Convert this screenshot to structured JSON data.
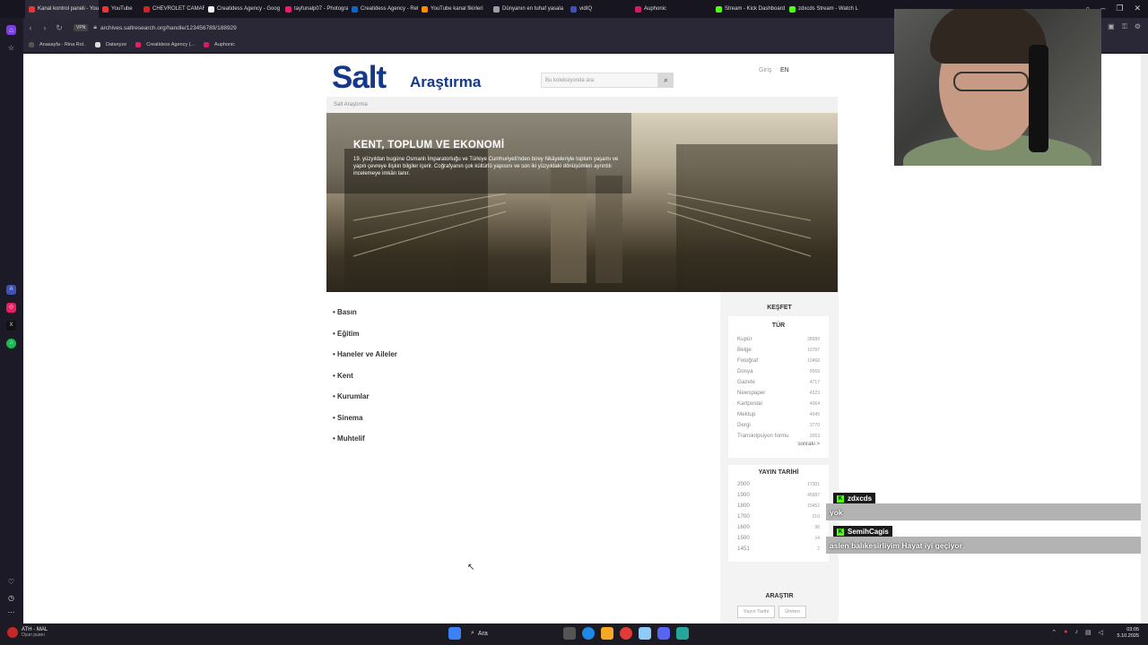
{
  "browser": {
    "tabs": [
      {
        "label": "Kanal kontrol paneli - You",
        "color": "#e53935"
      },
      {
        "label": "YouTube",
        "color": "#e53935"
      },
      {
        "label": "CHEVROLET CAMARO AUT",
        "color": "#c62828"
      },
      {
        "label": "Creatidess Agency - Goog",
        "color": "#f2f2f2"
      },
      {
        "label": "tayfunalp07 - Photograph",
        "color": "#e91e63"
      },
      {
        "label": "Creatidess Agency - Rekla",
        "color": "#1565c0"
      },
      {
        "label": "YouTube kanal fikirleri",
        "color": "#fb8c00"
      },
      {
        "label": "Dünyanın en tuhaf yasala",
        "color": "#9e9e9e"
      },
      {
        "label": "vidIQ",
        "color": "#3f51b5"
      },
      {
        "label": "Auphonic",
        "color": "#d81b60"
      },
      {
        "label": "Stream - Kick Dashboard",
        "color": "#53fc18"
      },
      {
        "label": "zdxcds Stream - Watch L",
        "color": "#53fc18"
      }
    ],
    "vpn_label": "VPN",
    "url": "archives.saltresearch.org/handle/123456789/188929",
    "bookmarks": [
      {
        "label": "Anasayfa - Rina Rol..",
        "color": "#555"
      },
      {
        "label": "Datanyze",
        "color": "#ddd"
      },
      {
        "label": "Creatidess Agency (...",
        "color": "#e91e63"
      },
      {
        "label": "Auphonic",
        "color": "#d81b60"
      }
    ]
  },
  "site": {
    "logo_main": "Salt",
    "logo_sub": "Araştırma",
    "search_placeholder": "Bu koleksiyonda ara",
    "login": "Giriş",
    "lang": "EN",
    "breadcrumb": "Salt Araştırma",
    "hero_title": "KENT, TOPLUM VE EKONOMİ",
    "hero_text": "19. yüzyıldan bugüne Osmanlı İmparatorluğu ve Türkiye Cumhuriyeti'nden birey hikâyeleriyle toplum yaşamı ve yapılı çevreye ilişkin bilgiler içerir. Coğrafyanın çok kültürlü yapısını ve son iki yüzyıldaki dönüşümleri ayrıntılı incelemeye imkân tanır.",
    "categories": [
      "Basın",
      "Eğitim",
      "Haneler ve Aileler",
      "Kent",
      "Kurumlar",
      "Sinema",
      "Muhtelif"
    ],
    "discover_title": "KEŞFET",
    "type_title": "TÜR",
    "types": [
      {
        "label": "Kupür",
        "count": "28589"
      },
      {
        "label": "Belge",
        "count": "19787"
      },
      {
        "label": "Fotoğraf",
        "count": "10468"
      },
      {
        "label": "Dosya",
        "count": "5569"
      },
      {
        "label": "Gazete",
        "count": "4717"
      },
      {
        "label": "Newspaper",
        "count": "4323"
      },
      {
        "label": "Kartpostal",
        "count": "4064"
      },
      {
        "label": "Mektup",
        "count": "4045"
      },
      {
        "label": "Dergi",
        "count": "3770"
      },
      {
        "label": "Transkripsiyon formu",
        "count": "2053"
      }
    ],
    "more_label": "sonraki >",
    "date_title": "YAYIN TARİHİ",
    "dates": [
      {
        "label": "2000",
        "count": "17301"
      },
      {
        "label": "1900",
        "count": "45587"
      },
      {
        "label": "1800",
        "count": "15452"
      },
      {
        "label": "1700",
        "count": "210"
      },
      {
        "label": "1600",
        "count": "96"
      },
      {
        "label": "1500",
        "count": "14"
      },
      {
        "label": "1451",
        "count": "2"
      }
    ],
    "search_section_title": "ARAŞTIR",
    "search_buttons": [
      "Yayın Tarihi",
      "Üreten"
    ]
  },
  "chat": [
    {
      "user": "zdxcds",
      "message": "yok"
    },
    {
      "user": "SemihCagis",
      "message": "aslen balıkesirliyim Hayat iyi geçiyor"
    }
  ],
  "taskbar": {
    "weather_title": "ATH - MAL",
    "weather_sub": "Oyun puanı",
    "search_label": "Ara",
    "time": "03:05",
    "date": "5.10.2025"
  }
}
